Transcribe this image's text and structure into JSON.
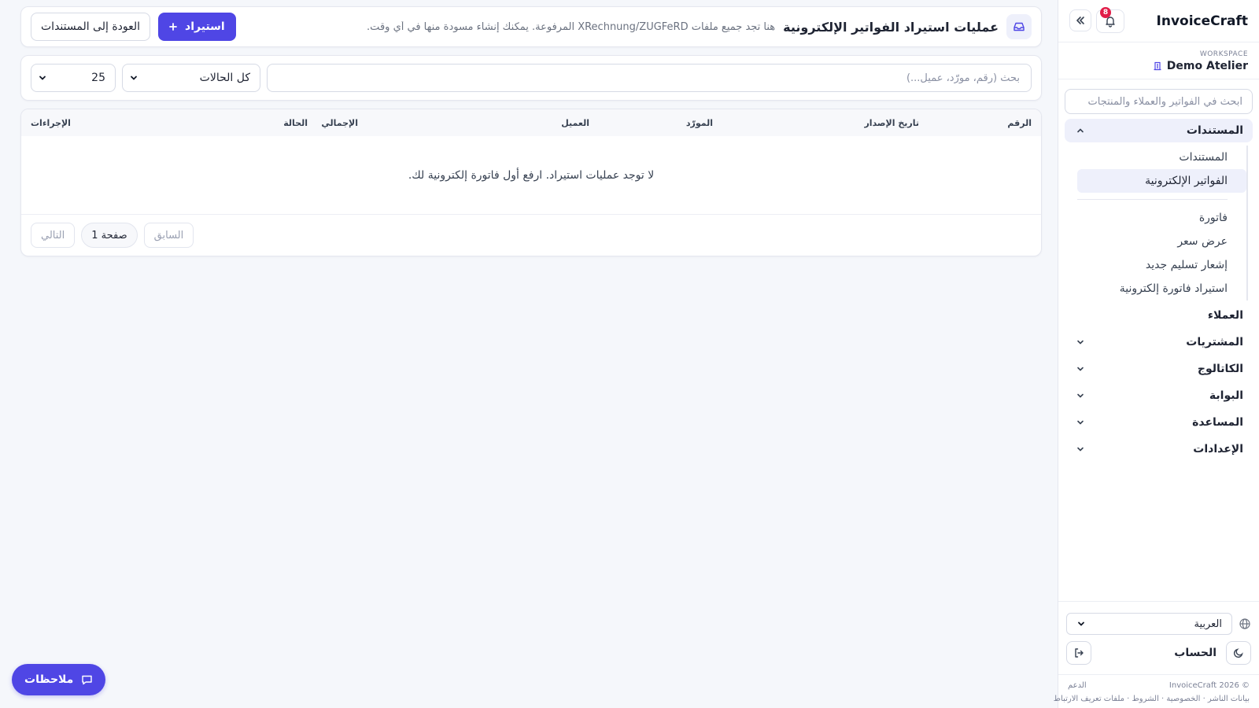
{
  "sidebar": {
    "brand": "InvoiceCraft",
    "notification_count": "8",
    "workspace_label": "WORKSPACE",
    "workspace_name": "Demo Atelier",
    "search_placeholder": "ابحث في الفواتير والعملاء والمنتجات",
    "documents_section": "المستندات",
    "sub_items": {
      "documents": "المستندات",
      "einvoices": "الفواتير الإلكترونية",
      "invoice": "فاتورة",
      "quote": "عرض سعر",
      "delivery_note": "إشعار تسليم جديد",
      "import_einvoice": "استيراد فاتورة إلكترونية"
    },
    "customers": "العملاء",
    "purchases": "المشتريات",
    "catalog": "الكاتالوج",
    "portal": "البوابة",
    "help": "المساعدة",
    "settings": "الإعدادات",
    "language": "العربية",
    "account": "الحساب",
    "footer_copyright": "© 2026 InvoiceCraft",
    "footer_support": "الدعم",
    "footer_links": "بيانات الناشر · الخصوصية · الشروط · ملفات تعريف الارتباط"
  },
  "header": {
    "title": "عمليات استيراد الفواتير الإلكترونية",
    "description": "هنا تجد جميع ملفات XRechnung/ZUGFeRD المرفوعة. يمكنك إنشاء مسودة منها في أي وقت.",
    "import_button": "استيراد",
    "back_button": "العودة إلى المستندات"
  },
  "filters": {
    "search_placeholder": "بحث (رقم، مورّد، عميل...)",
    "status_value": "كل الحالات",
    "page_size": "25"
  },
  "table": {
    "columns": {
      "number": "الرقم",
      "issue_date": "تاريخ الإصدار",
      "supplier": "المورّد",
      "customer": "العميل",
      "total": "الإجمالي",
      "status": "الحالة",
      "actions": "الإجراءات"
    },
    "empty_message": "لا توجد عمليات استيراد. ارفع أول فاتورة إلكترونية لك."
  },
  "pagination": {
    "previous": "السابق",
    "page": "صفحة 1",
    "next": "التالي"
  },
  "feedback_button": "ملاحظات",
  "colors": {
    "accent": "#4f46e5",
    "badge": "#e11d48",
    "background": "#f5f7fb"
  }
}
